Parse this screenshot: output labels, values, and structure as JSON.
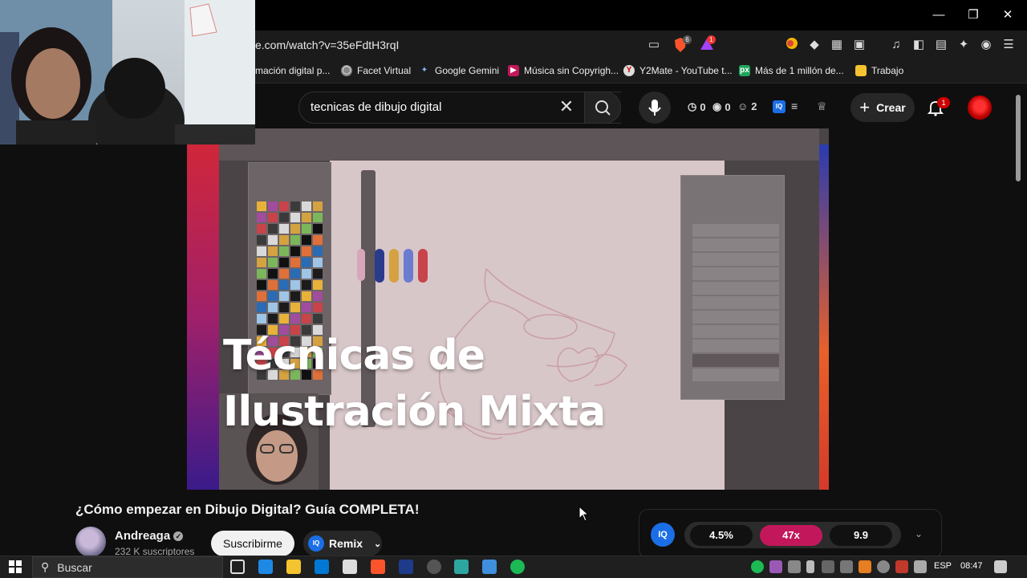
{
  "browser": {
    "url": "e.com/watch?v=35eFdtH3rqI",
    "badges": {
      "brave_count": "6",
      "alert_count": "1"
    },
    "bookmarks": [
      {
        "label": "mación digital p...",
        "icon": "bookmark-page-icon"
      },
      {
        "label": "Facet Virtual",
        "icon": "globe-icon"
      },
      {
        "label": "Google Gemini",
        "icon": "gemini-icon"
      },
      {
        "label": "Música sin Copyrigh...",
        "icon": "youtube-icon"
      },
      {
        "label": "Y2Mate - YouTube t...",
        "icon": "y2mate-icon"
      },
      {
        "label": "Más de 1 millón de...",
        "icon": "px-icon"
      },
      {
        "label": "Trabajo",
        "icon": "folder-icon"
      }
    ]
  },
  "youtube": {
    "search": {
      "query": "tecnicas de dibujo digital"
    },
    "stats": {
      "history": "0",
      "views": "0",
      "users": "2"
    },
    "create_label": "Crear",
    "notifications": "1",
    "video": {
      "overlay_title_line1": "Técnicas de",
      "overlay_title_line2": "Ilustración Mixta"
    },
    "title": "¿Cómo empezar en Dibujo Digital? Guía COMPLETA!",
    "channel": {
      "name": "Andreaga",
      "subscribers": "232 K suscriptores",
      "subscribe_label": "Suscribirme",
      "remix_label": "Remix"
    },
    "metrics": {
      "logo": "IQ",
      "ctr": "4.5%",
      "multiplier": "47x",
      "score": "9.9"
    }
  },
  "taskbar": {
    "search_label": "Buscar",
    "language": "ESP",
    "time": "08:47"
  },
  "colors": {
    "accent_red": "#cc0000",
    "metrics_pink": "#c2185b",
    "iq_blue": "#1b6ee6"
  }
}
